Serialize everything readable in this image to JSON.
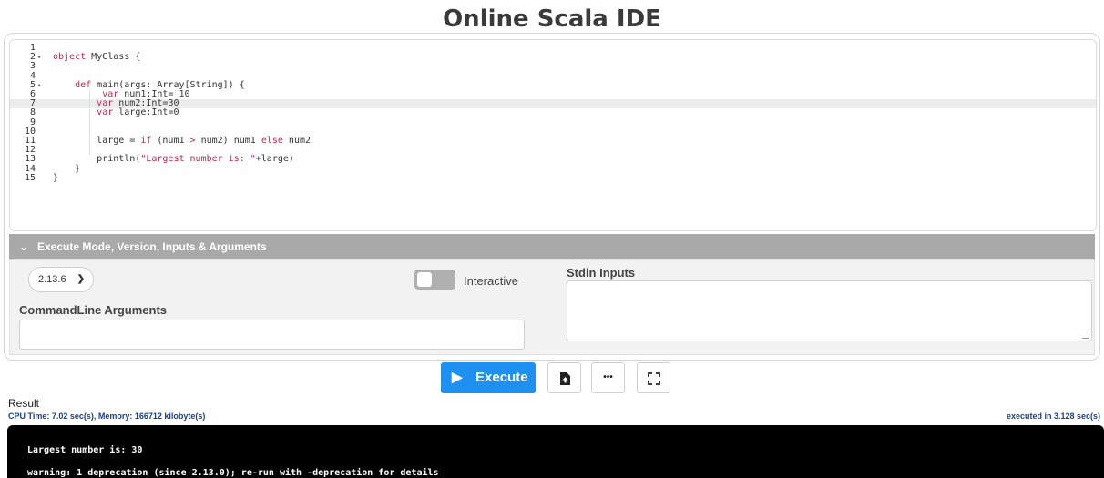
{
  "title": "Online Scala IDE",
  "editor": {
    "lines": [
      {
        "n": "1",
        "fold": "",
        "code": [
          {
            "t": "",
            "c": ""
          }
        ]
      },
      {
        "n": "2",
        "fold": "▾",
        "code": [
          {
            "t": "object",
            "c": "kw"
          },
          {
            "t": " MyClass {",
            "c": ""
          }
        ]
      },
      {
        "n": "3",
        "fold": "",
        "code": [
          {
            "t": "",
            "c": ""
          }
        ]
      },
      {
        "n": "4",
        "fold": "",
        "code": [
          {
            "t": "",
            "c": ""
          }
        ]
      },
      {
        "n": "5",
        "fold": "▾",
        "code": [
          {
            "t": "    ",
            "c": ""
          },
          {
            "t": "def",
            "c": "kw"
          },
          {
            "t": " main(args: Array[String]) {",
            "c": ""
          }
        ]
      },
      {
        "n": "6",
        "fold": "",
        "code": [
          {
            "t": "         ",
            "c": ""
          },
          {
            "t": "var",
            "c": "kw"
          },
          {
            "t": " num1:Int= 10",
            "c": ""
          }
        ]
      },
      {
        "n": "7",
        "fold": "",
        "code": [
          {
            "t": "        ",
            "c": ""
          },
          {
            "t": "var",
            "c": "kw"
          },
          {
            "t": " num2:Int=30",
            "c": ""
          }
        ]
      },
      {
        "n": "8",
        "fold": "",
        "code": [
          {
            "t": "        ",
            "c": ""
          },
          {
            "t": "var",
            "c": "kw"
          },
          {
            "t": " large:Int=0",
            "c": ""
          }
        ]
      },
      {
        "n": "9",
        "fold": "",
        "code": [
          {
            "t": "",
            "c": ""
          }
        ]
      },
      {
        "n": "10",
        "fold": "",
        "code": [
          {
            "t": "",
            "c": ""
          }
        ]
      },
      {
        "n": "11",
        "fold": "",
        "code": [
          {
            "t": "        large = ",
            "c": ""
          },
          {
            "t": "if",
            "c": "kw"
          },
          {
            "t": " (num1 ",
            "c": ""
          },
          {
            "t": ">",
            "c": "kw"
          },
          {
            "t": " num2) num1 ",
            "c": ""
          },
          {
            "t": "else",
            "c": "kw"
          },
          {
            "t": " num2",
            "c": ""
          }
        ]
      },
      {
        "n": "12",
        "fold": "",
        "code": [
          {
            "t": "",
            "c": ""
          }
        ]
      },
      {
        "n": "13",
        "fold": "",
        "code": [
          {
            "t": "        println(",
            "c": ""
          },
          {
            "t": "\"Largest number is: \"",
            "c": "str"
          },
          {
            "t": "+large)",
            "c": ""
          }
        ]
      },
      {
        "n": "14",
        "fold": "",
        "code": [
          {
            "t": "    }",
            "c": ""
          }
        ]
      },
      {
        "n": "15",
        "fold": "",
        "code": [
          {
            "t": "}",
            "c": ""
          }
        ]
      }
    ],
    "active_line": 7
  },
  "execute_section": {
    "header": "Execute Mode, Version, Inputs & Arguments",
    "version_value": "2.13.6",
    "interactive_label": "Interactive",
    "interactive_on": false,
    "stdin_label": "Stdin Inputs",
    "stdin_value": "",
    "cmdline_label": "CommandLine Arguments",
    "cmdline_value": ""
  },
  "toolbar": {
    "execute_label": "Execute",
    "more_label": "•••"
  },
  "result": {
    "label": "Result",
    "stats": "CPU Time: 7.02 sec(s), Memory: 166712 kilobyte(s)",
    "executed_in": "executed in 3.128 sec(s)",
    "output_lines": [
      "Largest number is: 30",
      "warning: 1 deprecation (since 2.13.0); re-run with -deprecation for details"
    ]
  },
  "colors": {
    "execute_button": "#1e90ef",
    "header_bar": "#a9a9a9",
    "keyword": "#c7254e",
    "stats_text": "#1a3f8a"
  }
}
